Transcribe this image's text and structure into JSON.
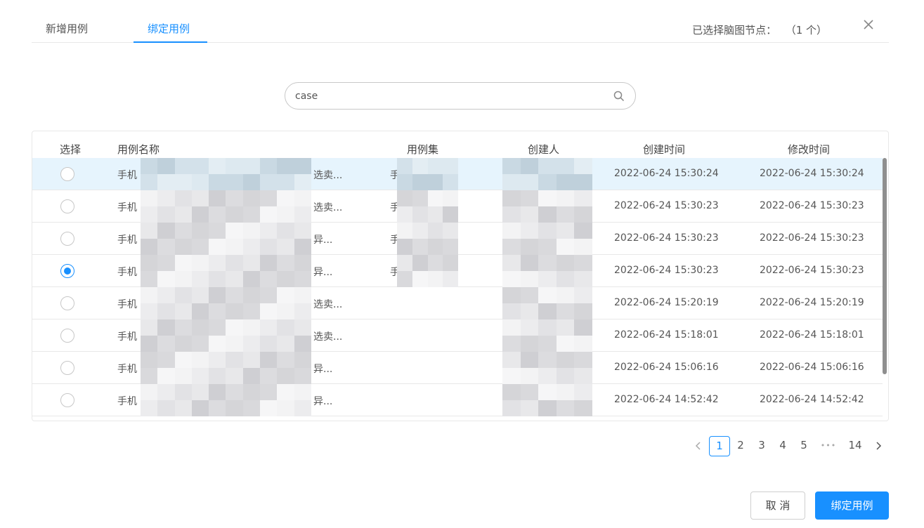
{
  "tabs": [
    {
      "label": "新增用例",
      "active": false
    },
    {
      "label": "绑定用例",
      "active": true
    }
  ],
  "selected_info": {
    "label": "已选择脑图节点：",
    "count": "（1 个）"
  },
  "search": {
    "value": "case"
  },
  "table": {
    "headers": [
      "选择",
      "用例名称",
      "用例集",
      "创建人",
      "创建时间",
      "修改时间"
    ],
    "rows": [
      {
        "name_prefix": "手机",
        "name_suffix": "选卖...",
        "set_prefix": "手",
        "created": "2022-06-24 15:30:24",
        "modified": "2022-06-24 15:30:24",
        "selected": false,
        "highlighted": true
      },
      {
        "name_prefix": "手机",
        "name_suffix": "选卖...",
        "set_prefix": "手",
        "created": "2022-06-24 15:30:23",
        "modified": "2022-06-24 15:30:23",
        "selected": false,
        "highlighted": false
      },
      {
        "name_prefix": "手机",
        "name_suffix": "异...",
        "set_prefix": "手",
        "created": "2022-06-24 15:30:23",
        "modified": "2022-06-24 15:30:23",
        "selected": false,
        "highlighted": false
      },
      {
        "name_prefix": "手机",
        "name_suffix": "异...",
        "set_prefix": "手",
        "created": "2022-06-24 15:30:23",
        "modified": "2022-06-24 15:30:23",
        "selected": true,
        "highlighted": false
      },
      {
        "name_prefix": "手机",
        "name_suffix": "选卖...",
        "set_prefix": "",
        "created": "2022-06-24 15:20:19",
        "modified": "2022-06-24 15:20:19",
        "selected": false,
        "highlighted": false
      },
      {
        "name_prefix": "手机",
        "name_suffix": "选卖...",
        "set_prefix": "",
        "created": "2022-06-24 15:18:01",
        "modified": "2022-06-24 15:18:01",
        "selected": false,
        "highlighted": false
      },
      {
        "name_prefix": "手机",
        "name_suffix": "异...",
        "set_prefix": "",
        "created": "2022-06-24 15:06:16",
        "modified": "2022-06-24 15:06:16",
        "selected": false,
        "highlighted": false
      },
      {
        "name_prefix": "手机",
        "name_suffix": "异...",
        "set_prefix": "",
        "created": "2022-06-24 14:52:42",
        "modified": "2022-06-24 14:52:42",
        "selected": false,
        "highlighted": false
      }
    ]
  },
  "pagination": {
    "pages": [
      "1",
      "2",
      "3",
      "4",
      "5"
    ],
    "ellipsis": "•••",
    "last": "14",
    "current": "1"
  },
  "buttons": {
    "cancel": "取 消",
    "bind": "绑定用例"
  },
  "colors": {
    "accent": "#1890ff",
    "row_highlight": "#e6f4fd",
    "border": "#e8e8e8"
  }
}
